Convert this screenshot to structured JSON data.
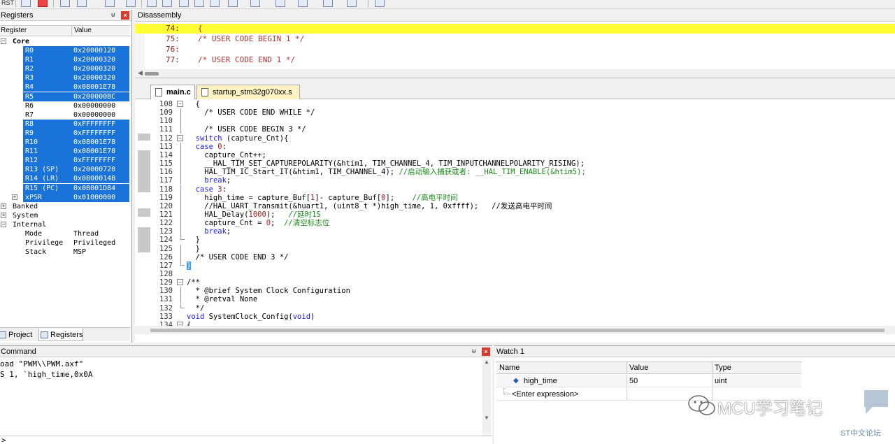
{
  "toolbar": {
    "rst_label": "RST"
  },
  "registers": {
    "title": "Registers",
    "col_register": "Register",
    "col_value": "Value",
    "core_label": "Core",
    "rows": [
      {
        "name": "R0",
        "value": "0x20000120"
      },
      {
        "name": "R1",
        "value": "0x20000320"
      },
      {
        "name": "R2",
        "value": "0x20000320"
      },
      {
        "name": "R3",
        "value": "0x20000320"
      },
      {
        "name": "R4",
        "value": "0x08001E78"
      },
      {
        "name": "R5",
        "value": "0x200000BC"
      },
      {
        "name": "R6",
        "value": "0x00000000"
      },
      {
        "name": "R7",
        "value": "0x00000000"
      },
      {
        "name": "R8",
        "value": "0xFFFFFFFF"
      },
      {
        "name": "R9",
        "value": "0xFFFFFFFF"
      },
      {
        "name": "R10",
        "value": "0x08001E78"
      },
      {
        "name": "R11",
        "value": "0x08001E78"
      },
      {
        "name": "R12",
        "value": "0xFFFFFFFF"
      },
      {
        "name": "R13 (SP)",
        "value": "0x20000720"
      },
      {
        "name": "R14 (LR)",
        "value": "0x0800014B"
      },
      {
        "name": "R15 (PC)",
        "value": "0x08001D84"
      },
      {
        "name": "xPSR",
        "value": "0x01000000"
      }
    ],
    "banked_label": "Banked",
    "system_label": "System",
    "internal_label": "Internal",
    "internal": [
      {
        "name": "Mode",
        "value": "Thread"
      },
      {
        "name": "Privilege",
        "value": "Privileged"
      },
      {
        "name": "Stack",
        "value": "MSP"
      }
    ],
    "tab_project": "Project",
    "tab_registers": "Registers"
  },
  "disassembly": {
    "title": "Disassembly",
    "rows": [
      {
        "ln": "74:",
        "text": "{"
      },
      {
        "ln": "75:",
        "text": "  /* USER CODE BEGIN 1 */"
      },
      {
        "ln": "76:",
        "text": ""
      },
      {
        "ln": "77:",
        "text": "  /* USER CODE END 1 */"
      }
    ]
  },
  "editor": {
    "tabs": [
      {
        "label": "main.c"
      },
      {
        "label": "startup_stm32g070xx.s"
      }
    ],
    "lines": [
      {
        "n": "108",
        "code": "  {"
      },
      {
        "n": "109",
        "code": "    /* USER CODE END WHILE */"
      },
      {
        "n": "110",
        "code": ""
      },
      {
        "n": "111",
        "code": "    /* USER CODE BEGIN 3 */"
      },
      {
        "n": "112",
        "code": "  switch (capture_Cnt){"
      },
      {
        "n": "113",
        "code": "  case 0:"
      },
      {
        "n": "114",
        "code": "    capture_Cnt++;"
      },
      {
        "n": "115",
        "code": "    __HAL_TIM_SET_CAPTUREPOLARITY(&htim1, TIM_CHANNEL_4, TIM_INPUTCHANNELPOLARITY_RISING);"
      },
      {
        "n": "116",
        "code": "    HAL_TIM_IC_Start_IT(&htim1, TIM_CHANNEL_4); //启动输入捕获或者: __HAL_TIM_ENABLE(&htim5);"
      },
      {
        "n": "117",
        "code": "    break;"
      },
      {
        "n": "118",
        "code": "  case 3:"
      },
      {
        "n": "119",
        "code": "    high_time = capture_Buf[1]- capture_Buf[0];    //高电平时间"
      },
      {
        "n": "120",
        "code": "    //HAL_UART_Transmit(&huart1, (uint8_t *)high_time, 1, 0xffff);   //发送高电平时间"
      },
      {
        "n": "121",
        "code": "    HAL_Delay(1000);   //延时1S"
      },
      {
        "n": "122",
        "code": "    capture_Cnt = 0;  //清空标志位"
      },
      {
        "n": "123",
        "code": "    break;"
      },
      {
        "n": "124",
        "code": "  }"
      },
      {
        "n": "125",
        "code": "  }"
      },
      {
        "n": "126",
        "code": "  /* USER CODE END 3 */"
      },
      {
        "n": "127",
        "code": "}"
      },
      {
        "n": "128",
        "code": ""
      },
      {
        "n": "129",
        "code": "/**"
      },
      {
        "n": "130",
        "code": "  * @brief System Clock Configuration"
      },
      {
        "n": "131",
        "code": "  * @retval None"
      },
      {
        "n": "132",
        "code": "  */"
      },
      {
        "n": "133",
        "code": "void SystemClock_Config(void)"
      },
      {
        "n": "134",
        "code": "{"
      }
    ]
  },
  "command": {
    "title": "Command",
    "lines": [
      "oad \"PWM\\\\PWM.axf\"",
      "S 1, `high_time,0x0A"
    ],
    "prompt": ">"
  },
  "watch": {
    "title": "Watch 1",
    "col_name": "Name",
    "col_value": "Value",
    "col_type": "Type",
    "rows": [
      {
        "name": "high_time",
        "value": "50",
        "type": "uint"
      },
      {
        "name": "<Enter expression>",
        "value": "",
        "type": ""
      }
    ]
  },
  "watermark": {
    "main": "MCU学习笔记",
    "sub": "ST中文论坛"
  }
}
